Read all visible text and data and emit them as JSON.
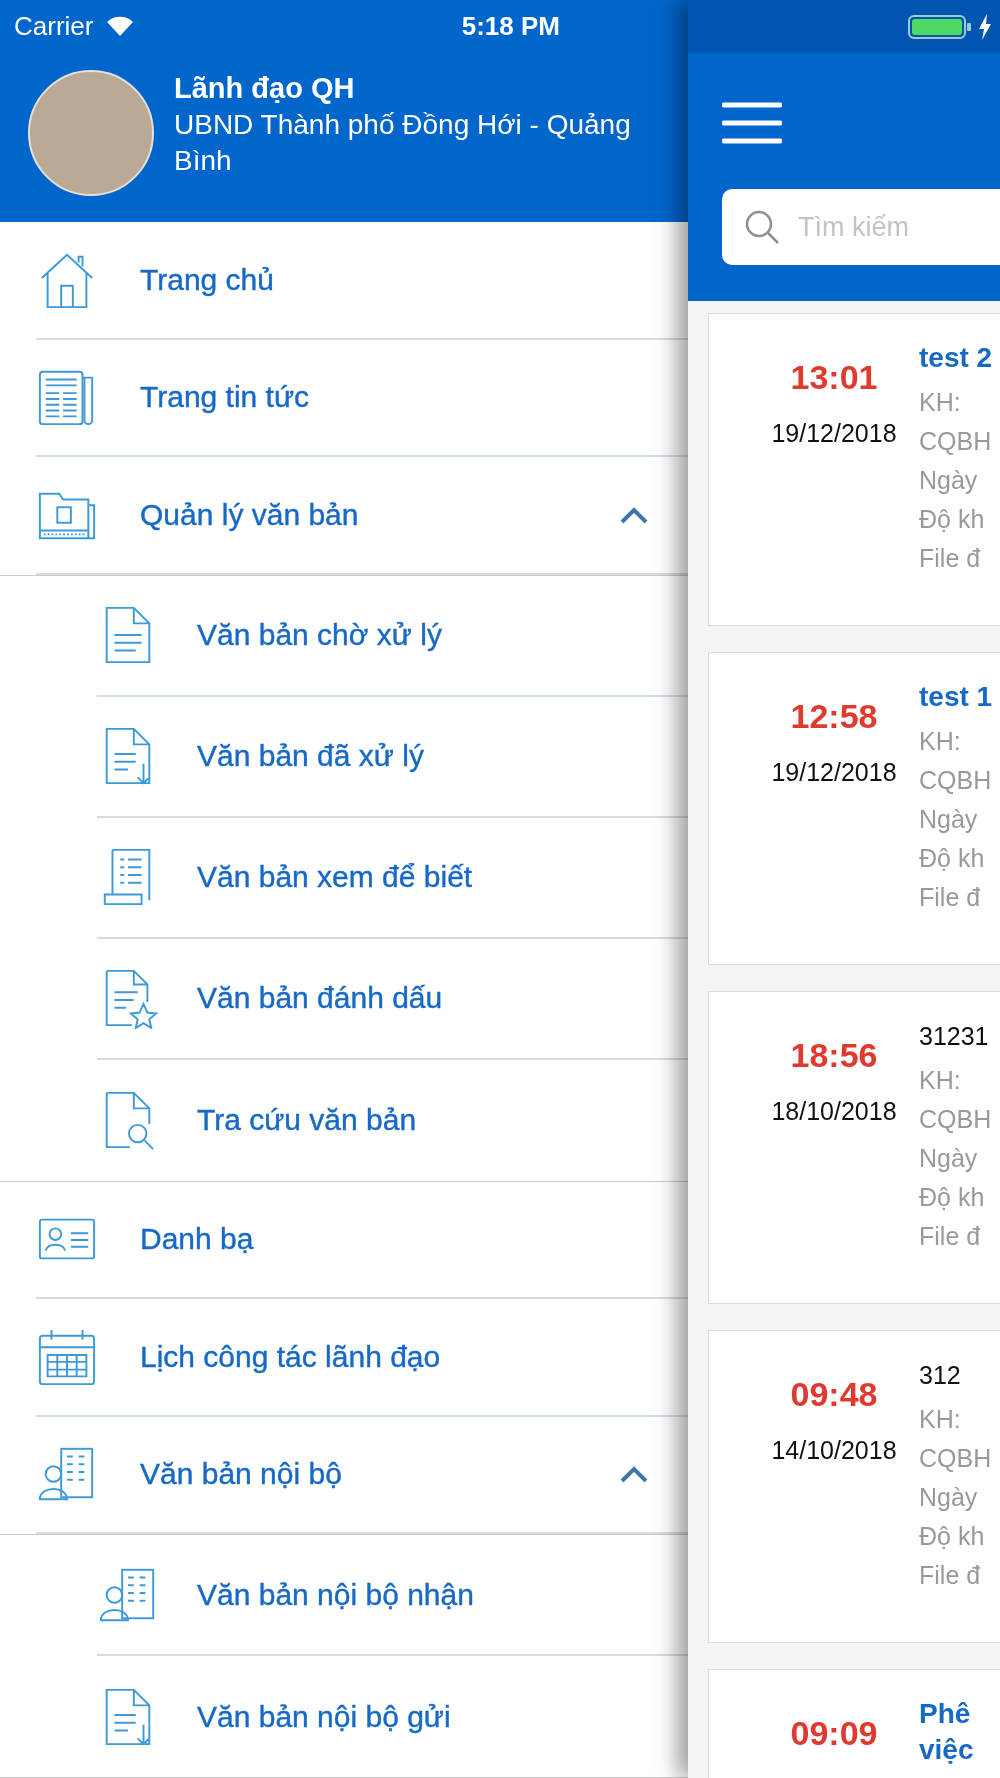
{
  "status_bar": {
    "carrier": "Carrier",
    "time": "5:18 PM"
  },
  "profile": {
    "name": "Lãnh đạo QH",
    "organization": "UBND Thành phố Đồng Hới - Quảng Bình"
  },
  "menu": [
    {
      "label": "Trang chủ"
    },
    {
      "label": "Trang tin tức"
    },
    {
      "label": "Quản lý văn bản",
      "expanded": true,
      "children": [
        {
          "label": "Văn bản chờ xử lý"
        },
        {
          "label": "Văn bản đã xử lý"
        },
        {
          "label": "Văn bản xem để biết"
        },
        {
          "label": "Văn bản đánh dấu"
        },
        {
          "label": "Tra cứu văn bản"
        }
      ]
    },
    {
      "label": "Danh bạ"
    },
    {
      "label": "Lịch công tác lãnh đạo"
    },
    {
      "label": "Văn bản nội bộ",
      "expanded": true,
      "children": [
        {
          "label": "Văn bản nội bộ nhận"
        },
        {
          "label": "Văn bản nội bộ gửi"
        }
      ]
    }
  ],
  "search": {
    "placeholder": "Tìm kiếm"
  },
  "documents": [
    {
      "time": "13:01",
      "date": "19/12/2018",
      "kind": "link",
      "title_lines": [
        "test 2"
      ],
      "lines": [
        "KH:",
        "CQBH",
        "Ngày",
        "Độ kh",
        "File đ"
      ]
    },
    {
      "time": "12:58",
      "date": "19/12/2018",
      "kind": "link",
      "title_lines": [
        "test 1"
      ],
      "lines": [
        "KH:",
        "CQBH",
        "Ngày",
        "Độ kh",
        "File đ"
      ]
    },
    {
      "time": "18:56",
      "date": "18/10/2018",
      "kind": "plain",
      "title_lines": [
        "31231"
      ],
      "lines": [
        "KH:",
        "CQBH",
        "Ngày",
        "Độ kh",
        "File đ"
      ]
    },
    {
      "time": "09:48",
      "date": "14/10/2018",
      "kind": "plain",
      "title_lines": [
        "312"
      ],
      "lines": [
        "KH:",
        "CQBH",
        "Ngày",
        "Độ kh",
        "File đ"
      ]
    },
    {
      "time": "09:09",
      "kind": "link",
      "title_lines": [
        "Phê",
        "việc"
      ]
    }
  ]
}
